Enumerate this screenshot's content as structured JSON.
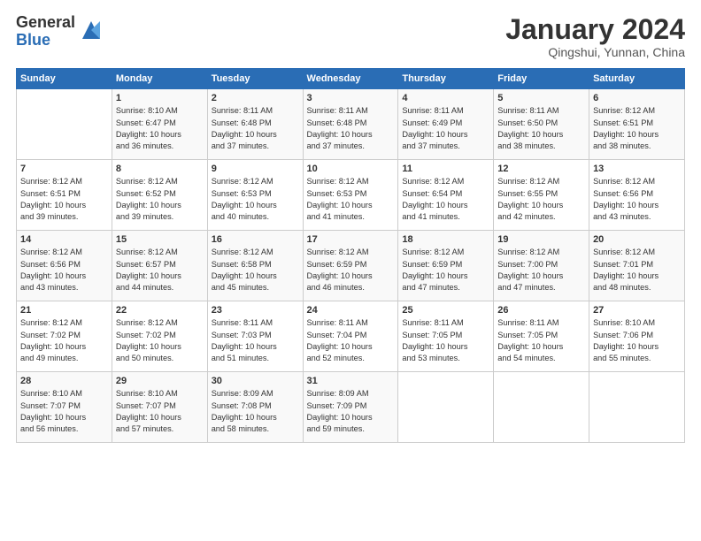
{
  "header": {
    "logo_general": "General",
    "logo_blue": "Blue",
    "month_title": "January 2024",
    "subtitle": "Qingshui, Yunnan, China"
  },
  "days_of_week": [
    "Sunday",
    "Monday",
    "Tuesday",
    "Wednesday",
    "Thursday",
    "Friday",
    "Saturday"
  ],
  "weeks": [
    [
      {
        "day": "",
        "sunrise": "",
        "sunset": "",
        "daylight": ""
      },
      {
        "day": "1",
        "sunrise": "Sunrise: 8:10 AM",
        "sunset": "Sunset: 6:47 PM",
        "daylight": "Daylight: 10 hours and 36 minutes."
      },
      {
        "day": "2",
        "sunrise": "Sunrise: 8:11 AM",
        "sunset": "Sunset: 6:48 PM",
        "daylight": "Daylight: 10 hours and 37 minutes."
      },
      {
        "day": "3",
        "sunrise": "Sunrise: 8:11 AM",
        "sunset": "Sunset: 6:48 PM",
        "daylight": "Daylight: 10 hours and 37 minutes."
      },
      {
        "day": "4",
        "sunrise": "Sunrise: 8:11 AM",
        "sunset": "Sunset: 6:49 PM",
        "daylight": "Daylight: 10 hours and 37 minutes."
      },
      {
        "day": "5",
        "sunrise": "Sunrise: 8:11 AM",
        "sunset": "Sunset: 6:50 PM",
        "daylight": "Daylight: 10 hours and 38 minutes."
      },
      {
        "day": "6",
        "sunrise": "Sunrise: 8:12 AM",
        "sunset": "Sunset: 6:51 PM",
        "daylight": "Daylight: 10 hours and 38 minutes."
      }
    ],
    [
      {
        "day": "7",
        "sunrise": "Sunrise: 8:12 AM",
        "sunset": "Sunset: 6:51 PM",
        "daylight": "Daylight: 10 hours and 39 minutes."
      },
      {
        "day": "8",
        "sunrise": "Sunrise: 8:12 AM",
        "sunset": "Sunset: 6:52 PM",
        "daylight": "Daylight: 10 hours and 39 minutes."
      },
      {
        "day": "9",
        "sunrise": "Sunrise: 8:12 AM",
        "sunset": "Sunset: 6:53 PM",
        "daylight": "Daylight: 10 hours and 40 minutes."
      },
      {
        "day": "10",
        "sunrise": "Sunrise: 8:12 AM",
        "sunset": "Sunset: 6:53 PM",
        "daylight": "Daylight: 10 hours and 41 minutes."
      },
      {
        "day": "11",
        "sunrise": "Sunrise: 8:12 AM",
        "sunset": "Sunset: 6:54 PM",
        "daylight": "Daylight: 10 hours and 41 minutes."
      },
      {
        "day": "12",
        "sunrise": "Sunrise: 8:12 AM",
        "sunset": "Sunset: 6:55 PM",
        "daylight": "Daylight: 10 hours and 42 minutes."
      },
      {
        "day": "13",
        "sunrise": "Sunrise: 8:12 AM",
        "sunset": "Sunset: 6:56 PM",
        "daylight": "Daylight: 10 hours and 43 minutes."
      }
    ],
    [
      {
        "day": "14",
        "sunrise": "Sunrise: 8:12 AM",
        "sunset": "Sunset: 6:56 PM",
        "daylight": "Daylight: 10 hours and 43 minutes."
      },
      {
        "day": "15",
        "sunrise": "Sunrise: 8:12 AM",
        "sunset": "Sunset: 6:57 PM",
        "daylight": "Daylight: 10 hours and 44 minutes."
      },
      {
        "day": "16",
        "sunrise": "Sunrise: 8:12 AM",
        "sunset": "Sunset: 6:58 PM",
        "daylight": "Daylight: 10 hours and 45 minutes."
      },
      {
        "day": "17",
        "sunrise": "Sunrise: 8:12 AM",
        "sunset": "Sunset: 6:59 PM",
        "daylight": "Daylight: 10 hours and 46 minutes."
      },
      {
        "day": "18",
        "sunrise": "Sunrise: 8:12 AM",
        "sunset": "Sunset: 6:59 PM",
        "daylight": "Daylight: 10 hours and 47 minutes."
      },
      {
        "day": "19",
        "sunrise": "Sunrise: 8:12 AM",
        "sunset": "Sunset: 7:00 PM",
        "daylight": "Daylight: 10 hours and 47 minutes."
      },
      {
        "day": "20",
        "sunrise": "Sunrise: 8:12 AM",
        "sunset": "Sunset: 7:01 PM",
        "daylight": "Daylight: 10 hours and 48 minutes."
      }
    ],
    [
      {
        "day": "21",
        "sunrise": "Sunrise: 8:12 AM",
        "sunset": "Sunset: 7:02 PM",
        "daylight": "Daylight: 10 hours and 49 minutes."
      },
      {
        "day": "22",
        "sunrise": "Sunrise: 8:12 AM",
        "sunset": "Sunset: 7:02 PM",
        "daylight": "Daylight: 10 hours and 50 minutes."
      },
      {
        "day": "23",
        "sunrise": "Sunrise: 8:11 AM",
        "sunset": "Sunset: 7:03 PM",
        "daylight": "Daylight: 10 hours and 51 minutes."
      },
      {
        "day": "24",
        "sunrise": "Sunrise: 8:11 AM",
        "sunset": "Sunset: 7:04 PM",
        "daylight": "Daylight: 10 hours and 52 minutes."
      },
      {
        "day": "25",
        "sunrise": "Sunrise: 8:11 AM",
        "sunset": "Sunset: 7:05 PM",
        "daylight": "Daylight: 10 hours and 53 minutes."
      },
      {
        "day": "26",
        "sunrise": "Sunrise: 8:11 AM",
        "sunset": "Sunset: 7:05 PM",
        "daylight": "Daylight: 10 hours and 54 minutes."
      },
      {
        "day": "27",
        "sunrise": "Sunrise: 8:10 AM",
        "sunset": "Sunset: 7:06 PM",
        "daylight": "Daylight: 10 hours and 55 minutes."
      }
    ],
    [
      {
        "day": "28",
        "sunrise": "Sunrise: 8:10 AM",
        "sunset": "Sunset: 7:07 PM",
        "daylight": "Daylight: 10 hours and 56 minutes."
      },
      {
        "day": "29",
        "sunrise": "Sunrise: 8:10 AM",
        "sunset": "Sunset: 7:07 PM",
        "daylight": "Daylight: 10 hours and 57 minutes."
      },
      {
        "day": "30",
        "sunrise": "Sunrise: 8:09 AM",
        "sunset": "Sunset: 7:08 PM",
        "daylight": "Daylight: 10 hours and 58 minutes."
      },
      {
        "day": "31",
        "sunrise": "Sunrise: 8:09 AM",
        "sunset": "Sunset: 7:09 PM",
        "daylight": "Daylight: 10 hours and 59 minutes."
      },
      {
        "day": "",
        "sunrise": "",
        "sunset": "",
        "daylight": ""
      },
      {
        "day": "",
        "sunrise": "",
        "sunset": "",
        "daylight": ""
      },
      {
        "day": "",
        "sunrise": "",
        "sunset": "",
        "daylight": ""
      }
    ]
  ]
}
